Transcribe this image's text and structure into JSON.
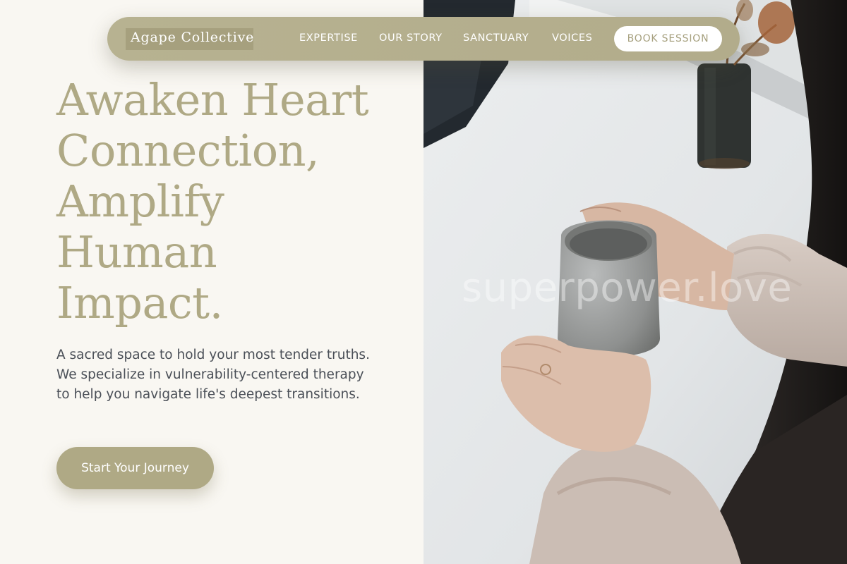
{
  "brand": {
    "name": "Agape Collective"
  },
  "nav": {
    "links": [
      "EXPERTISE",
      "OUR STORY",
      "SANCTUARY",
      "VOICES"
    ],
    "cta_label": "BOOK SESSION"
  },
  "hero": {
    "title_lines": [
      "Awaken Heart",
      "Connection,",
      "Amplify",
      "Human",
      "Impact."
    ],
    "subtitle": "A sacred space to hold your most tender truths. We specialize in vulnerability-centered therapy to help you navigate life's deepest transitions.",
    "cta_label": "Start Your Journey"
  },
  "photo": {
    "watermark": "superpower.love"
  },
  "colors": {
    "accent": "#afa985",
    "background": "#f9f7f2",
    "body_text": "#4a4f57",
    "button_text": "#ffffff"
  }
}
